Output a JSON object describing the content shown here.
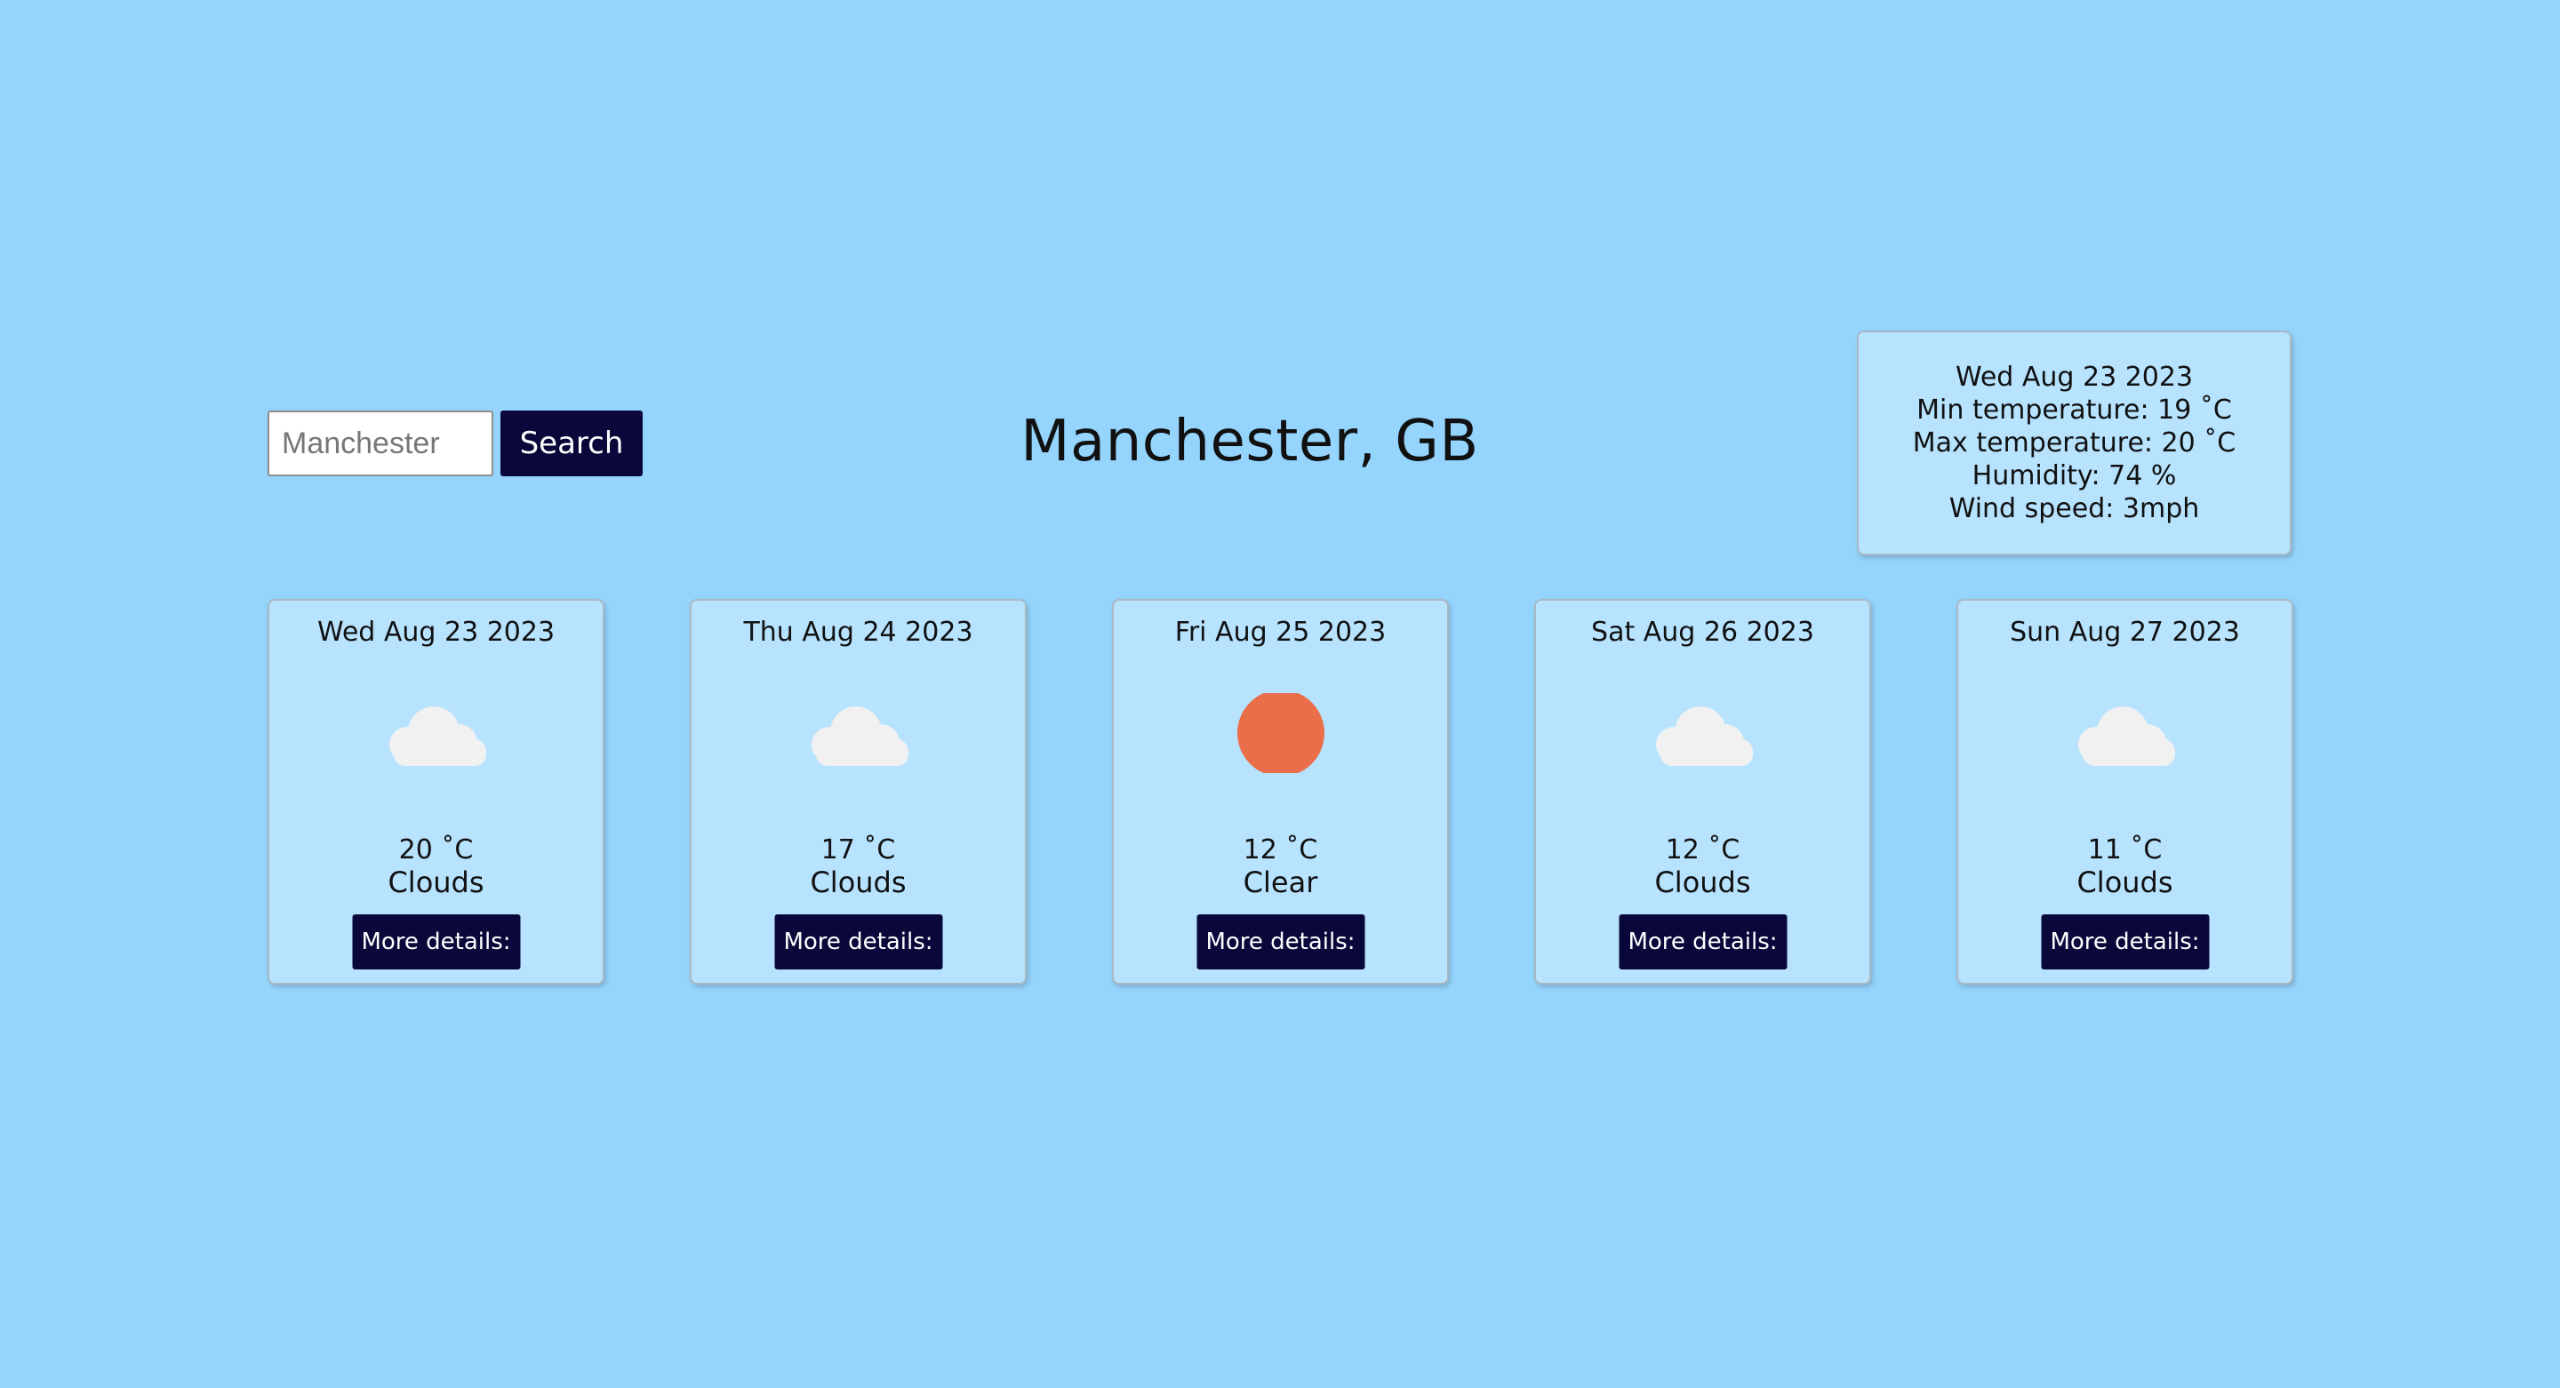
{
  "search": {
    "placeholder": "Manchester",
    "button_label": "Search"
  },
  "header": {
    "city": "Manchester, GB"
  },
  "details": {
    "date": "Wed Aug 23 2023",
    "min_temp": "Min temperature: 19 ˚C",
    "max_temp": "Max temperature: 20 ˚C",
    "humidity": "Humidity: 74 %",
    "wind": "Wind speed: 3mph"
  },
  "forecast": [
    {
      "date": "Wed Aug 23 2023",
      "temp": "20 ˚C",
      "condition": "Clouds",
      "icon": "cloud-icon",
      "button": "More details:"
    },
    {
      "date": "Thu Aug 24 2023",
      "temp": "17 ˚C",
      "condition": "Clouds",
      "icon": "cloud-icon",
      "button": "More details:"
    },
    {
      "date": "Fri Aug 25 2023",
      "temp": "12 ˚C",
      "condition": "Clear",
      "icon": "sun-icon",
      "button": "More details:"
    },
    {
      "date": "Sat Aug 26 2023",
      "temp": "12 ˚C",
      "condition": "Clouds",
      "icon": "cloud-icon",
      "button": "More details:"
    },
    {
      "date": "Sun Aug 27 2023",
      "temp": "11 ˚C",
      "condition": "Clouds",
      "icon": "cloud-icon",
      "button": "More details:"
    }
  ],
  "colors": {
    "background": "#94d4fd",
    "card": "#b7e3fe",
    "button": "#0a083a",
    "sun": "#eb6e4b",
    "cloud": "#f1f1f1"
  }
}
